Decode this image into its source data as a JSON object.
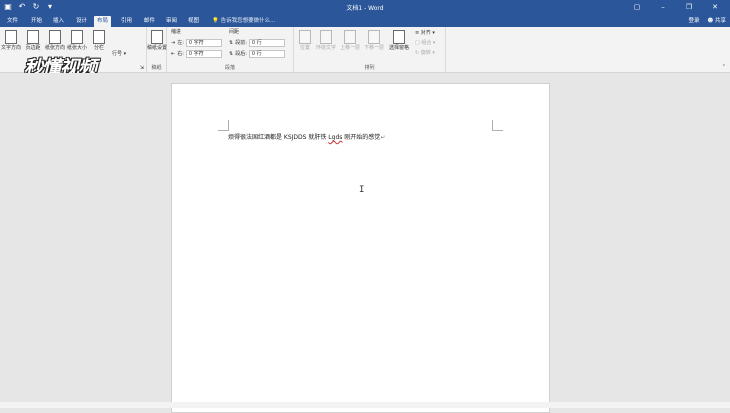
{
  "window": {
    "title": "文档1 - Word"
  },
  "ribbon_tabs": [
    "文件",
    "开始",
    "插入",
    "设计",
    "布局",
    "引用",
    "邮件",
    "审阅",
    "视图"
  ],
  "active_tab": "布局",
  "tell_me": "告诉我您想要做什么...",
  "account": {
    "login": "登录",
    "share": "共享"
  },
  "page_setup": {
    "buttons": [
      "文字方向",
      "页边距",
      "纸张方向",
      "纸张大小",
      "分栏"
    ],
    "line_numbers": "行号",
    "group_label": "页面设置"
  },
  "draft": {
    "button": "稿纸设置",
    "group_label": "稿纸"
  },
  "paragraph": {
    "indent_label": "缩进",
    "spacing_label": "间距",
    "left_label": "左:",
    "left_value": "0 字符",
    "right_label": "右:",
    "right_value": "0 字符",
    "before_label": "段前:",
    "before_value": "0 行",
    "after_label": "段后:",
    "after_value": "0 行",
    "group_label": "段落"
  },
  "arrange": {
    "buttons": [
      "位置",
      "环绕文字",
      "上移一层",
      "下移一层",
      "选择窗格"
    ],
    "small": [
      "对齐",
      "组合",
      "旋转"
    ],
    "group_label": "排列"
  },
  "watermark": "秒懂视频",
  "document": {
    "text_before": "烦得很法国红酒都是 KSJDDS 就肝铁 ",
    "misspelled": "Lgds",
    "text_after": " 刚开始的感觉",
    "pilcrow": "↵"
  },
  "cursor": "I"
}
